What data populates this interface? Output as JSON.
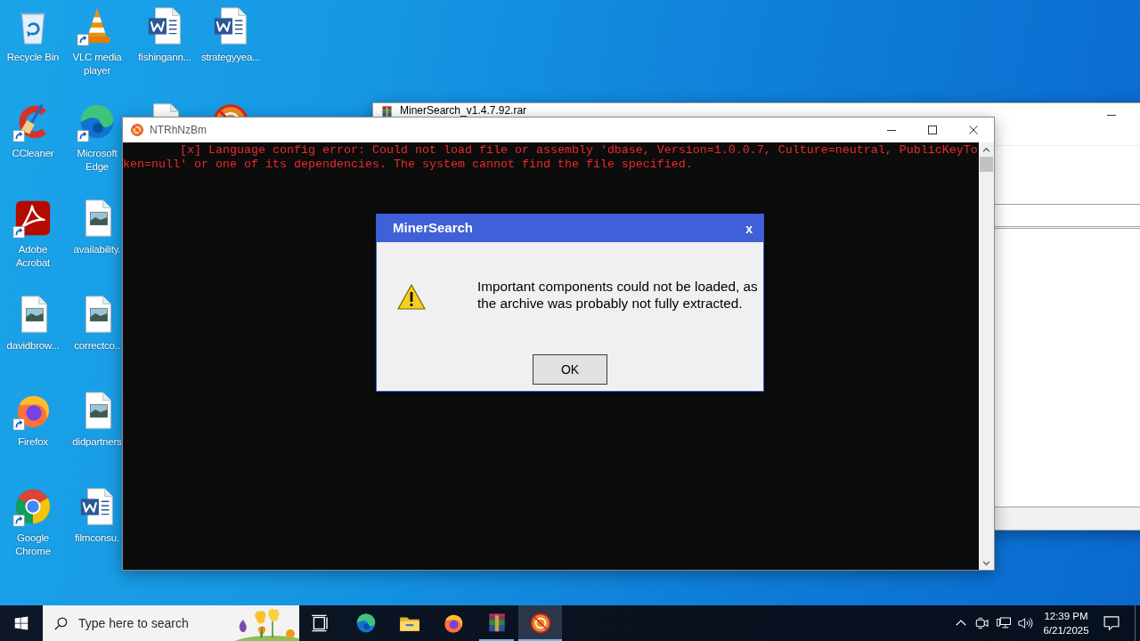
{
  "desktop_columns": [
    {
      "icons": [
        {
          "label": "Recycle Bin",
          "kind": "recycle-bin",
          "shortcut": false
        },
        {
          "label": "CCleaner",
          "kind": "ccleaner",
          "shortcut": true
        },
        {
          "label": "Adobe Acrobat",
          "kind": "acrobat",
          "shortcut": true
        },
        {
          "label": "davidbrow...",
          "kind": "image-file",
          "shortcut": false
        },
        {
          "label": "Firefox",
          "kind": "firefox",
          "shortcut": true
        },
        {
          "label": "Google Chrome",
          "kind": "chrome",
          "shortcut": true
        }
      ]
    },
    {
      "icons": [
        {
          "label": "VLC media player",
          "kind": "vlc",
          "shortcut": true
        },
        {
          "label": "Microsoft Edge",
          "kind": "edge",
          "shortcut": true
        },
        {
          "label": "availability.",
          "kind": "image-file",
          "shortcut": false
        },
        {
          "label": "correctco..",
          "kind": "image-file",
          "shortcut": false
        },
        {
          "label": "didpartners",
          "kind": "image-file",
          "shortcut": false
        },
        {
          "label": "filmconsu.",
          "kind": "word-doc",
          "shortcut": false
        }
      ]
    },
    {
      "icons": [
        {
          "label": "fishingann...",
          "kind": "word-doc",
          "shortcut": false
        },
        {
          "kind": "document"
        }
      ]
    },
    {
      "icons": [
        {
          "label": "strategyyea...",
          "kind": "word-doc",
          "shortcut": false
        },
        {
          "kind": "miner-app"
        }
      ]
    }
  ],
  "archive_window": {
    "title": "MinerSearch_v1.4.7.92.rar"
  },
  "console_window": {
    "title": "NTRhNzBm",
    "lines": [
      {
        "kind": "error",
        "text": "[x] Language config error: Could not load file or assembly 'dbase, Version=1.0.0.7, Culture=neutral, PublicKeyToken=null' or one of its dependencies. The system cannot find the file specified."
      }
    ]
  },
  "dialog": {
    "title": "MinerSearch",
    "close": "x",
    "message": "Important components could not be loaded, as the archive was probably not fully extracted.",
    "buttons": [
      "OK"
    ]
  },
  "taskbar": {
    "search": {
      "placeholder": "Type here to search"
    },
    "apps": [
      {
        "kind": "task-view",
        "running": false,
        "active": false
      },
      {
        "kind": "edge",
        "running": false,
        "active": false
      },
      {
        "kind": "file-explorer",
        "running": false,
        "active": false
      },
      {
        "kind": "firefox",
        "running": false,
        "active": false
      },
      {
        "kind": "winrar",
        "running": true,
        "active": false
      },
      {
        "kind": "miner-app",
        "running": true,
        "active": true
      }
    ],
    "clock": {
      "time": "12:39 PM",
      "date": "6/21/2025"
    }
  }
}
